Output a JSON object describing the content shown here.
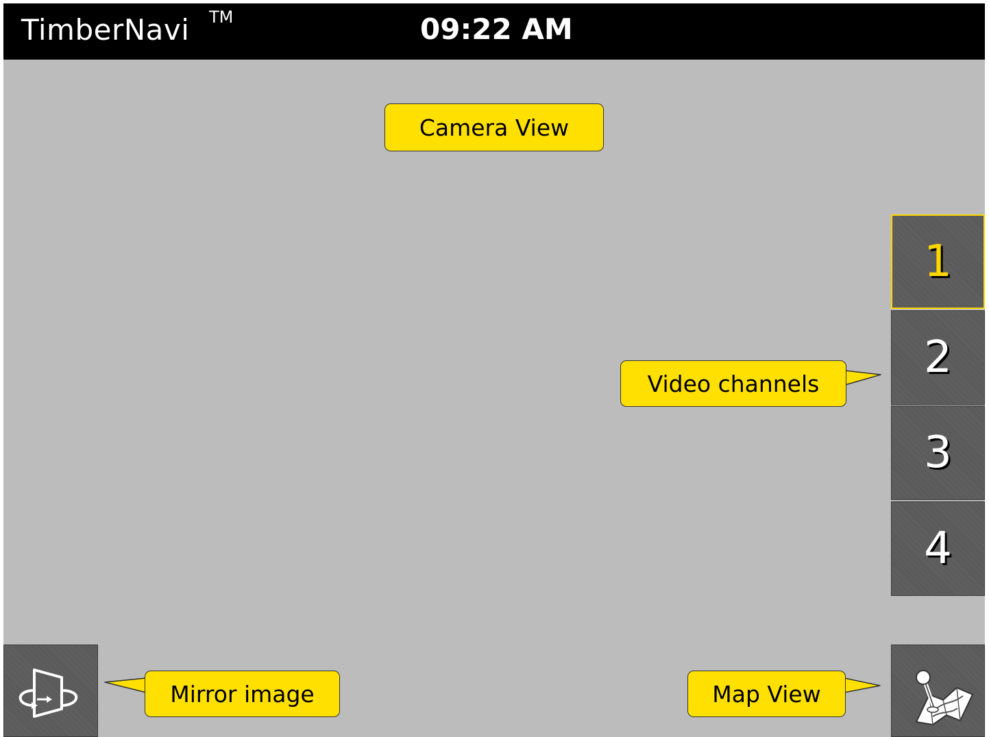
{
  "header": {
    "app_title": "TimberNavi",
    "trademark": "TM",
    "clock": "09:22 AM"
  },
  "callouts": {
    "camera_view": "Camera View",
    "video_channels": "Video channels",
    "mirror_image": "Mirror image",
    "map_view": "Map View"
  },
  "channels": [
    {
      "label": "1",
      "active": true
    },
    {
      "label": "2",
      "active": false
    },
    {
      "label": "3",
      "active": false
    },
    {
      "label": "4",
      "active": false
    }
  ],
  "buttons": {
    "mirror_icon": "mirror-flip-icon",
    "map_icon": "map-joystick-icon"
  },
  "colors": {
    "callout_fill": "#ffe000",
    "active_channel": "#ffd700",
    "background": "#bcbcbc",
    "header": "#000000"
  }
}
